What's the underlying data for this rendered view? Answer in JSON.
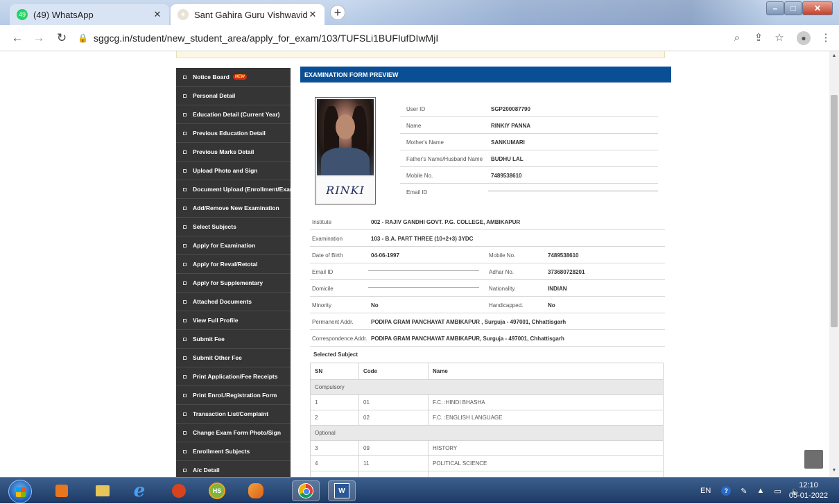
{
  "browser": {
    "tabs": [
      {
        "title": "(49) WhatsApp",
        "badge": "49",
        "favicon": "whatsapp-icon"
      },
      {
        "title": "Sant Gahira Guru Vishwavidyalay",
        "favicon": "university-icon"
      }
    ],
    "new_tab": "+",
    "url": "sggcg.in/student/new_student_area/apply_for_exam/103/TUFSLi1BUFIufDIwMjI",
    "accent": "#0a4f96"
  },
  "sidebar": {
    "new_badge": "NEW",
    "items": [
      "Notice Board",
      "Personal Detail",
      "Education Detail (Current Year)",
      "Previous Education Detail",
      "Previous Marks Detail",
      "Upload Photo and Sign",
      "Document Upload (Enrollment/Exam)",
      "Add/Remove New Examination",
      "Select Subjects",
      "Apply for Examination",
      "Apply for Reval/Retotal",
      "Apply for Supplementary",
      "Attached Documents",
      "View Full Profile",
      "Submit Fee",
      "Submit Other Fee",
      "Print Application/Fee Receipts",
      "Print Enrol./Registration Form",
      "Transaction List/Complaint",
      "Change Exam Form Photo/Sign",
      "Enrollment Subjects",
      "A/c Detail"
    ]
  },
  "form": {
    "header": "EXAMINATION FORM PREVIEW",
    "signature_text": "RINKI",
    "profile": [
      {
        "label": "User ID",
        "value": "SGP200087790"
      },
      {
        "label": "Name",
        "value": "RINKIY PANNA"
      },
      {
        "label": "Mother's Name",
        "value": "SANKUMARI"
      },
      {
        "label": "Father's Name/Husband Name",
        "value": "BUDHU LAL"
      },
      {
        "label": "Mobile No.",
        "value": "7489538610"
      },
      {
        "label": "Email ID",
        "value": ""
      }
    ],
    "institute": {
      "label": "Institute",
      "value": "002 - RAJIV GANDHI GOVT. P.G. COLLEGE, AMBIKAPUR"
    },
    "examination": {
      "label": "Examination",
      "value": "103 - B.A. PART THREE (10+2+3) 3YDC"
    },
    "dob": {
      "label": "Date of Birth",
      "value": "04-06-1997"
    },
    "mobile": {
      "label": "Mobile No.",
      "value": "7489538610"
    },
    "email": {
      "label": "Email ID",
      "value": ""
    },
    "adhar": {
      "label": "Adhar No.",
      "value": "373680728201"
    },
    "domicile": {
      "label": "Domicile",
      "value": ""
    },
    "nationality": {
      "label": "Nationality.",
      "value": "INDIAN"
    },
    "minority": {
      "label": "Minority",
      "value": "No"
    },
    "handicapped": {
      "label": "Handicapped.",
      "value": "No"
    },
    "permanent": {
      "label": "Permanent Addr.",
      "value": "PODIPA GRAM PANCHAYAT AMBIKAPUR , Surguja - 497001, Chhattisgarh"
    },
    "correspondence": {
      "label": "Correspondence Addr.",
      "value": "PODIPA GRAM PANCHAYAT AMBIKAPUR, Surguja - 497001, Chhattisgarh"
    },
    "selected_subject_label": "Selected Subject",
    "subject_headers": {
      "sn": "SN",
      "code": "Code",
      "name": "Name"
    },
    "groups": {
      "compulsory": "Compulsory",
      "optional": "Optional"
    },
    "subjects": [
      {
        "sn": "1",
        "code": "01",
        "name": "F.C. :HINDI BHASHA"
      },
      {
        "sn": "2",
        "code": "02",
        "name": "F.C. :ENGLISH LANGUAGE"
      },
      {
        "sn": "3",
        "code": "09",
        "name": "HISTORY"
      },
      {
        "sn": "4",
        "code": "11",
        "name": "POLITICAL SCIENCE"
      }
    ]
  },
  "taskbar": {
    "lang": "EN",
    "time": "12:10",
    "date": "05-01-2022",
    "hs_label": "HS",
    "word_label": "W"
  }
}
